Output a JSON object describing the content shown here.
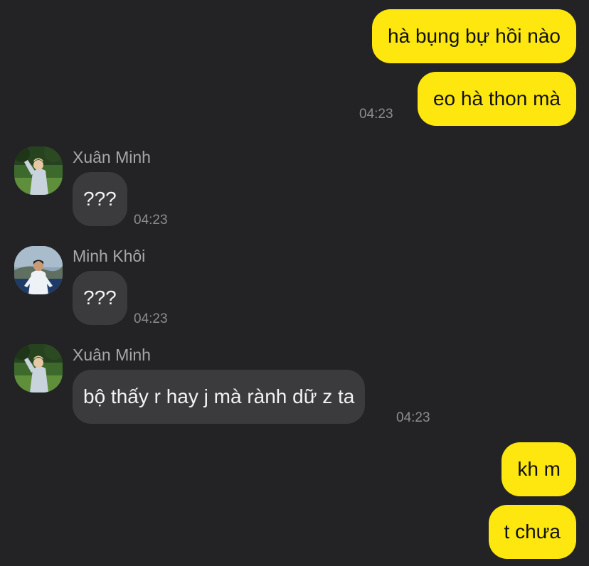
{
  "colors": {
    "background": "#232325",
    "outgoing_bubble": "#fde70f",
    "incoming_bubble": "#3b3b3d"
  },
  "messages": [
    {
      "direction": "out",
      "text": "hà bụng bự hồi nào"
    },
    {
      "direction": "out",
      "text": "eo hà thon mà",
      "time": "04:23"
    },
    {
      "direction": "in",
      "sender": "Xuân Minh",
      "avatar": "xuan-minh-avatar",
      "text": "???",
      "time": "04:23"
    },
    {
      "direction": "in",
      "sender": "Minh Khôi",
      "avatar": "minh-khoi-avatar",
      "text": "???",
      "time": "04:23"
    },
    {
      "direction": "in",
      "sender": "Xuân Minh",
      "avatar": "xuan-minh-avatar",
      "text": "bộ thấy r hay j mà rành dữ z ta",
      "time": "04:23"
    },
    {
      "direction": "out",
      "text": "kh m"
    },
    {
      "direction": "out",
      "text": "t chưa"
    }
  ]
}
